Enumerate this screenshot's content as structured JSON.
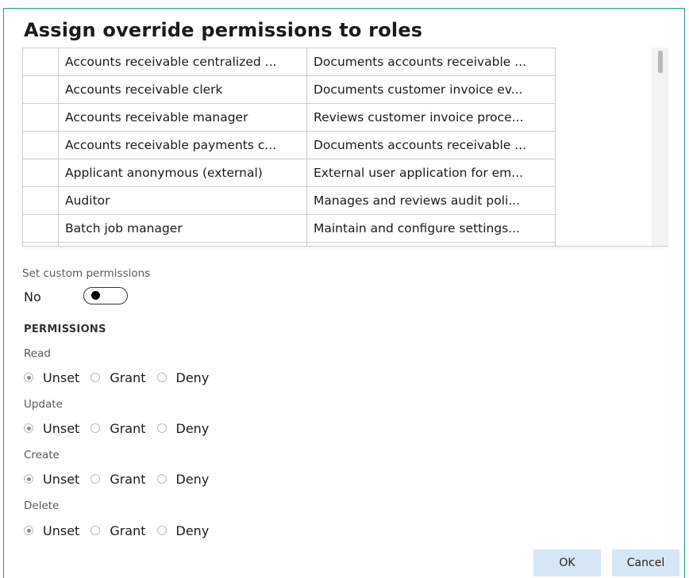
{
  "dialog": {
    "title": "Assign override permissions to roles"
  },
  "roles_grid": {
    "rows": [
      {
        "name": "Accounts receivable centralized ...",
        "description": "Documents accounts receivable ..."
      },
      {
        "name": "Accounts receivable clerk",
        "description": "Documents customer invoice ev..."
      },
      {
        "name": "Accounts receivable manager",
        "description": "Reviews customer invoice proce..."
      },
      {
        "name": "Accounts receivable payments c...",
        "description": "Documents accounts receivable ..."
      },
      {
        "name": "Applicant anonymous (external)",
        "description": "External user application for em..."
      },
      {
        "name": "Auditor",
        "description": "Manages and reviews audit poli..."
      },
      {
        "name": "Batch job manager",
        "description": "Maintain and configure settings..."
      }
    ]
  },
  "custom_permissions": {
    "label": "Set custom permissions",
    "value": "No"
  },
  "permissions": {
    "section_label": "PERMISSIONS",
    "groups": [
      {
        "label": "Read",
        "options": [
          "Unset",
          "Grant",
          "Deny"
        ],
        "selected": "Unset"
      },
      {
        "label": "Update",
        "options": [
          "Unset",
          "Grant",
          "Deny"
        ],
        "selected": "Unset"
      },
      {
        "label": "Create",
        "options": [
          "Unset",
          "Grant",
          "Deny"
        ],
        "selected": "Unset"
      },
      {
        "label": "Delete",
        "options": [
          "Unset",
          "Grant",
          "Deny"
        ],
        "selected": "Unset"
      }
    ]
  },
  "buttons": {
    "ok": "OK",
    "cancel": "Cancel"
  },
  "colors": {
    "frame_border": "#1ea08a",
    "button_bg": "#d6e6f4"
  }
}
